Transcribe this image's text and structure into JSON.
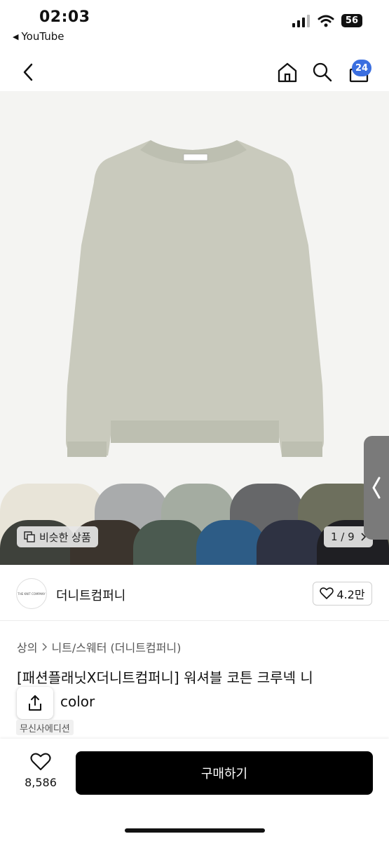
{
  "status_bar": {
    "time": "02:03",
    "back_app": "YouTube",
    "battery": "56"
  },
  "nav": {
    "cart_count": "24"
  },
  "gallery": {
    "similar_label": "비슷한 상품",
    "pager": "1 / 9",
    "swatch_colors": [
      "#e8e4d8",
      "#a9abac",
      "#a4aca1",
      "#666769",
      "#6d6f5d",
      "#3e413b",
      "#3b342d",
      "#4b5a50",
      "#2d5c86",
      "#2e3242",
      "#1f1f23"
    ]
  },
  "brand": {
    "logo_text": "THE KNIT COMPANY",
    "name": "더니트컴퍼니",
    "likes": "4.2만"
  },
  "breadcrumb": {
    "category": "상의",
    "sub_category": "니트/스웨터 (더니트컴퍼니)"
  },
  "product": {
    "title_line1": "[패션플래닛X더니트컴퍼니] 워셔블 코튼 크루넥 니",
    "title_line2": "color",
    "tag": "무신사에디션"
  },
  "bottom_bar": {
    "wish_count": "8,586",
    "buy_label": "구매하기"
  },
  "colors": {
    "accent": "#3b6fe0",
    "buy_button": "#000000",
    "sweater": "#c9cabd"
  }
}
